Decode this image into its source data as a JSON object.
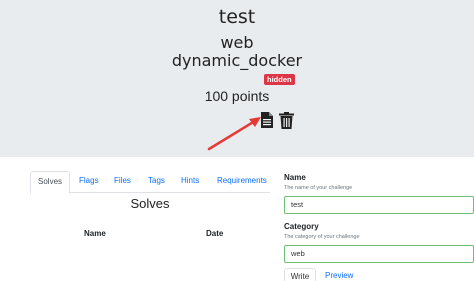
{
  "challenge": {
    "name": "test",
    "category": "web",
    "type": "dynamic_docker",
    "state_badge": "hidden",
    "points": "100 points"
  },
  "icons": {
    "file": "file-icon",
    "trash": "trash-icon",
    "arrow": "red-arrow-annotation"
  },
  "tabs": [
    "Solves",
    "Flags",
    "Files",
    "Tags",
    "Hints",
    "Requirements"
  ],
  "active_tab": "Solves",
  "solves": {
    "title": "Solves",
    "columns": [
      "Name",
      "Date"
    ]
  },
  "form": {
    "name_label": "Name",
    "name_help": "The name of your challenge",
    "name_value": "test",
    "category_label": "Category",
    "category_help": "The category of your challenge",
    "category_value": "web",
    "write_tab": "Write",
    "preview_tab": "Preview"
  },
  "colors": {
    "hero_bg": "#e9ecef",
    "badge": "#dc3545",
    "link": "#0d6efd",
    "input_border": "#6fbf73",
    "arrow": "#e53935"
  }
}
